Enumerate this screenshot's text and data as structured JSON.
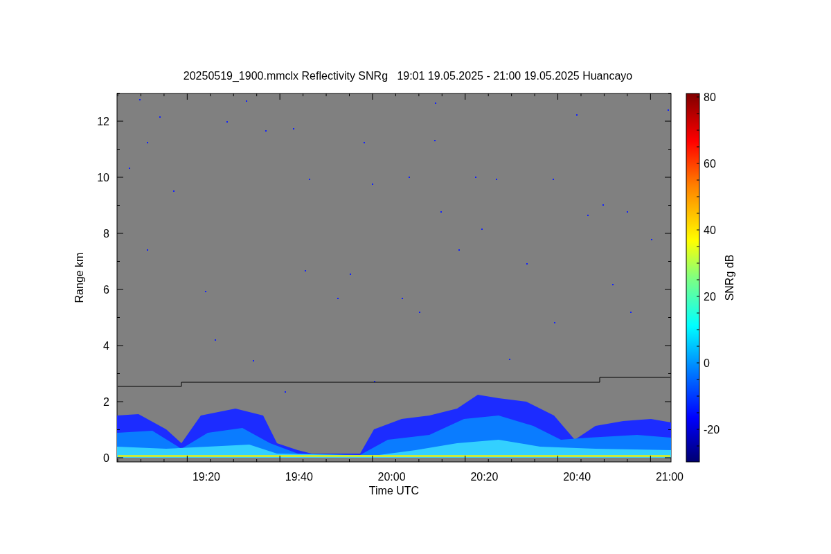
{
  "title": "20250519_1900.mmclx Reflectivity SNRg   19:01 19.05.2025 - 21:00 19.05.2025 Huancayo",
  "y_axis": {
    "label": "Range km",
    "ticks": [
      "12",
      "10",
      "8",
      "6",
      "4",
      "2",
      "0"
    ]
  },
  "x_axis": {
    "label": "Time UTC",
    "ticks": [
      "19:20",
      "19:40",
      "20:00",
      "20:20",
      "20:40",
      "21:00"
    ]
  },
  "colorbar": {
    "label": "SNRg dB",
    "ticks": [
      "80",
      "60",
      "40",
      "20",
      "0",
      "-20"
    ]
  }
}
